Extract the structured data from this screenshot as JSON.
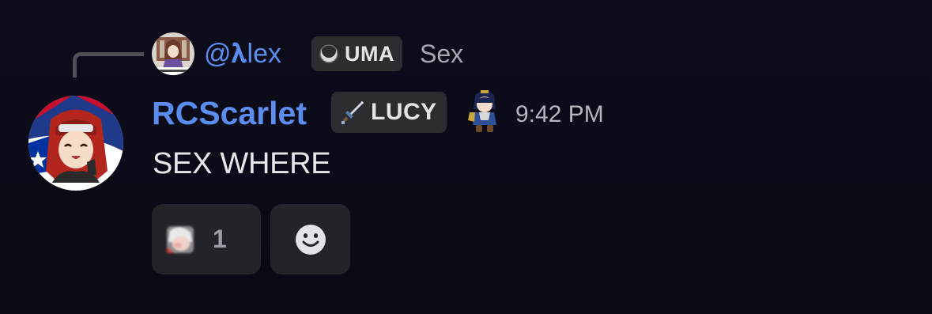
{
  "reply": {
    "author": "@𝛌lex",
    "tag": "UMA",
    "tag_icon": "moon-badge-icon",
    "content": "Sex",
    "avatar_icon": "horse-girl-avatar-icon"
  },
  "message": {
    "author": "RCScarlet",
    "tag": "LUCY",
    "tag_icon": "pixel-sword-icon",
    "decoration_icon": "chibi-figure-icon",
    "timestamp": "9:42 PM",
    "content": "SEX WHERE",
    "avatar_icon": "red-haired-anime-girl-avatar-icon"
  },
  "reactions": [
    {
      "emoji_icon": "blurred-face-emoji-icon",
      "count": "1"
    }
  ],
  "add_reaction_icon": "smiley-face-icon",
  "colors": {
    "background": "#0b0a17",
    "username": "#5b8def",
    "tag_bg": "#2b2d31",
    "reaction_bg": "#23242a",
    "message_text": "#e6e7ea",
    "muted_text": "#a7a9b1",
    "reply_line": "#4e5058"
  }
}
